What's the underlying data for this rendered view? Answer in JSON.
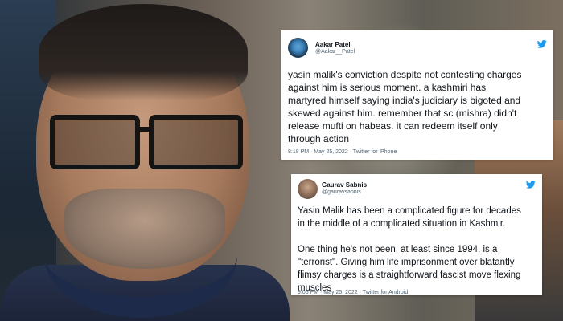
{
  "tweets": [
    {
      "name": "Aakar Patel",
      "handle": "@Aakar__Patel",
      "body": "yasin malik's conviction despite not contesting charges\nagainst him is serious moment. a kashmiri has\nmartyred himself saying india's judiciary is bigoted and\nskewed against him. remember that sc (mishra) didn't\nrelease mufti on habeas. it can redeem itself only\nthrough action",
      "meta": "8:18 PM · May 25, 2022 · Twitter for iPhone",
      "logo_icon": "twitter-bird-icon",
      "logo_color": "#1d9bf0"
    },
    {
      "name": "Gaurav Sabnis",
      "handle": "@gauravsabnis",
      "body": "Yasin Malik has been a complicated figure for decades\nin the middle of a complicated situation in Kashmir.\n\nOne thing he's not been, at least since 1994, is a\n\"terrorist\". Giving him life imprisonment over blatantly\nflimsy charges is a straightforward fascist move flexing\nmuscles",
      "meta": "9:06 PM · May 25, 2022 · Twitter for Android",
      "logo_icon": "twitter-bird-icon",
      "logo_color": "#1d9bf0"
    }
  ]
}
